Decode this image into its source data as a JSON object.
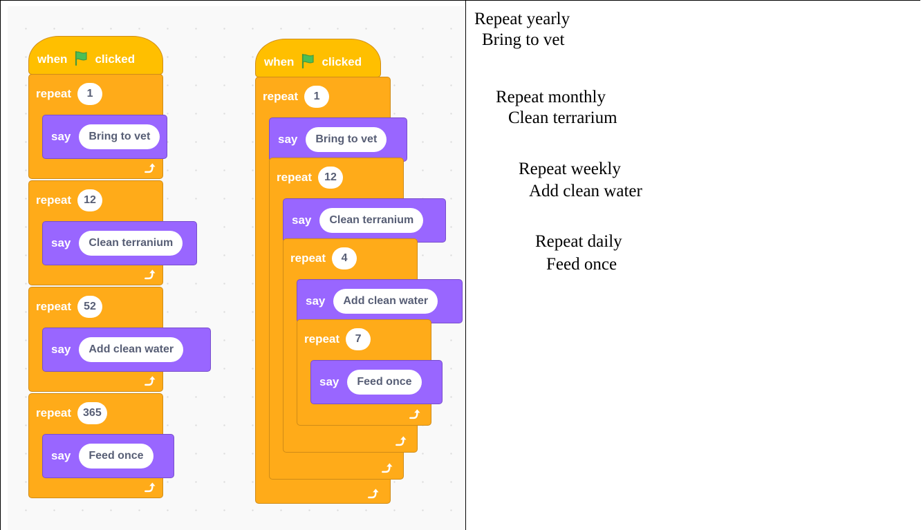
{
  "hat": {
    "when": "when",
    "clicked": "clicked"
  },
  "labels": {
    "repeat": "repeat",
    "say": "say"
  },
  "left_script": {
    "loops": [
      {
        "count": "1",
        "message": "Bring to vet"
      },
      {
        "count": "12",
        "message": "Clean terranium"
      },
      {
        "count": "52",
        "message": "Add clean water"
      },
      {
        "count": "365",
        "message": "Feed once"
      }
    ]
  },
  "right_script": {
    "loops": [
      {
        "count": "1",
        "message": "Bring to vet"
      },
      {
        "count": "12",
        "message": "Clean terranium"
      },
      {
        "count": "4",
        "message": "Add clean water"
      },
      {
        "count": "7",
        "message": "Feed once"
      }
    ]
  },
  "description": [
    "Repeat yearly",
    "Bring to vet",
    "Repeat monthly",
    "Clean terrarium",
    "Repeat weekly",
    "Add clean water",
    "Repeat daily",
    "Feed once"
  ],
  "colors": {
    "event": "#ffbf00",
    "control": "#ffab19",
    "looks": "#9966ff",
    "flag": "#4cbf56"
  }
}
